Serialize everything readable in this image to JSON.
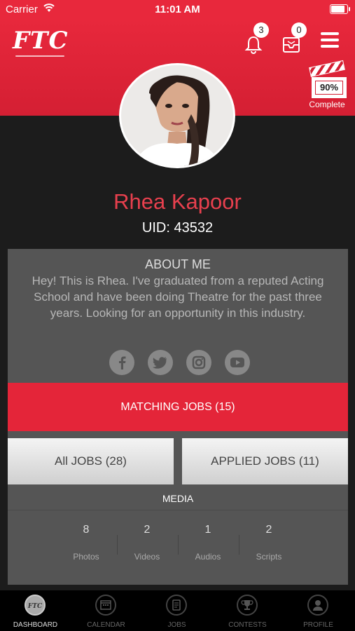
{
  "status_bar": {
    "carrier": "Carrier",
    "time": "11:01 AM",
    "battery_level": 0.95
  },
  "header": {
    "logo": "FTC",
    "notifications_count": "3",
    "messages_count": "0",
    "profile_completion": "90%",
    "profile_completion_label": "Complete",
    "accent_color": "#e8283c"
  },
  "profile": {
    "name": "Rhea Kapoor",
    "uid": "UID: 43532",
    "about_title": "ABOUT ME",
    "about_text": "Hey! This is Rhea. I've graduated from a reputed Acting School and have been doing Theatre for the past three years. Looking for an opportunity in this industry.",
    "social": [
      {
        "name": "facebook-icon",
        "glyph": "f"
      },
      {
        "name": "twitter-icon",
        "glyph": "t"
      },
      {
        "name": "instagram-icon",
        "glyph": "◘"
      },
      {
        "name": "youtube-icon",
        "glyph": "▶"
      }
    ]
  },
  "jobs": {
    "matching": "MATCHING JOBS (15)",
    "all": "All JOBS (28)",
    "applied": "APPLIED JOBS (11)"
  },
  "media": {
    "title": "MEDIA",
    "stats": [
      {
        "value": "8",
        "label": "Photos"
      },
      {
        "value": "2",
        "label": "Videos"
      },
      {
        "value": "1",
        "label": "Audios"
      },
      {
        "value": "2",
        "label": "Scripts"
      }
    ]
  },
  "tabs": [
    {
      "label": "DASHBOARD",
      "icon": "ftc-logo-icon"
    },
    {
      "label": "CALENDAR",
      "icon": "calendar-icon"
    },
    {
      "label": "JOBS",
      "icon": "jobs-icon"
    },
    {
      "label": "CONTESTS",
      "icon": "trophy-icon"
    },
    {
      "label": "PROFILE",
      "icon": "profile-icon"
    }
  ]
}
